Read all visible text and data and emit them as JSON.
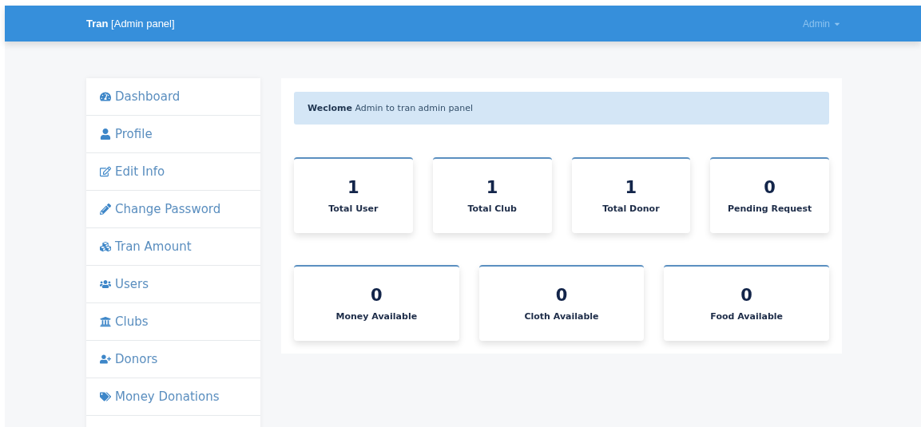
{
  "navbar": {
    "brand": "Tran",
    "subtitle": "[Admin panel]",
    "user_menu": "Admin"
  },
  "sidebar": {
    "items": [
      {
        "label": "Dashboard"
      },
      {
        "label": "Profile"
      },
      {
        "label": "Edit Info"
      },
      {
        "label": "Change Password"
      },
      {
        "label": "Tran Amount"
      },
      {
        "label": "Users"
      },
      {
        "label": "Clubs"
      },
      {
        "label": "Donors"
      },
      {
        "label": "Money Donations"
      }
    ]
  },
  "welcome": "**Weclome** Admin to tran admin panel",
  "stat_rows": [
    [
      {
        "value": "1",
        "label": "Total User"
      },
      {
        "value": "1",
        "label": "Total Club"
      },
      {
        "value": "1",
        "label": "Total Donor"
      },
      {
        "value": "0",
        "label": "Pending Request"
      }
    ],
    [
      {
        "value": "0",
        "label": "Money Available"
      },
      {
        "value": "0",
        "label": "Cloth Available"
      },
      {
        "value": "0",
        "label": "Food Available"
      }
    ]
  ]
}
